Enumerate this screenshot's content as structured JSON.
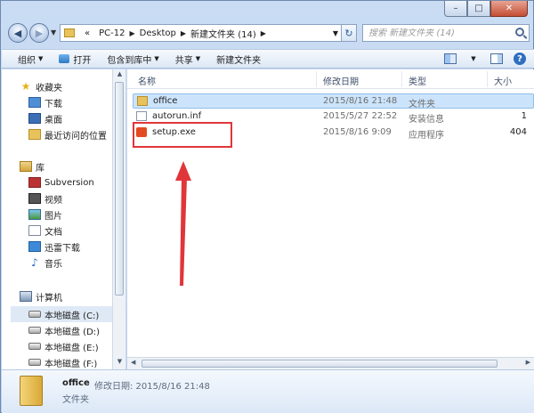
{
  "window": {
    "caption_buttons": {
      "minimize": "–",
      "maximize": "□",
      "close": "✕"
    }
  },
  "address": {
    "prefix": "«",
    "crumbs": [
      "PC-12",
      "Desktop",
      "新建文件夹 (14)"
    ]
  },
  "search": {
    "placeholder": "搜索 新建文件夹 (14)"
  },
  "toolbar": {
    "organize": "组织",
    "open": "打开",
    "include_in_library": "包含到库中",
    "share": "共享",
    "new_folder": "新建文件夹"
  },
  "navpane": {
    "favorites": "收藏夹",
    "downloads": "下载",
    "desktop": "桌面",
    "recent": "最近访问的位置",
    "libraries": "库",
    "subversion": "Subversion",
    "videos": "视频",
    "pictures": "图片",
    "documents": "文档",
    "thunder": "迅雷下载",
    "music": "音乐",
    "computer": "计算机",
    "drive_c": "本地磁盘 (C:)",
    "drive_d": "本地磁盘 (D:)",
    "drive_e": "本地磁盘 (E:)",
    "drive_f": "本地磁盘 (F:)"
  },
  "columns": {
    "name": "名称",
    "modified": "修改日期",
    "type": "类型",
    "size": "大小"
  },
  "files": [
    {
      "name": "office",
      "modified": "2015/8/16 21:48",
      "type": "文件夹",
      "size": ""
    },
    {
      "name": "autorun.inf",
      "modified": "2015/5/27 22:52",
      "type": "安装信息",
      "size": "1"
    },
    {
      "name": "setup.exe",
      "modified": "2015/8/16 9:09",
      "type": "应用程序",
      "size": "404"
    }
  ],
  "details": {
    "name": "office",
    "meta": "修改日期: 2015/8/16 21:48",
    "type": "文件夹"
  },
  "colors": {
    "highlight_box": "#e0363a",
    "arrow": "#e0363a",
    "selection": "#cce4fb"
  }
}
